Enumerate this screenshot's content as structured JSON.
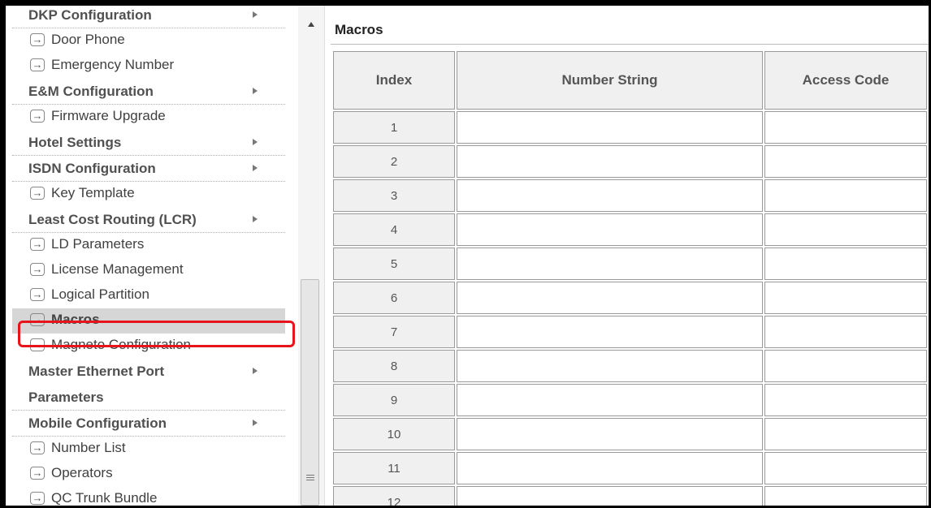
{
  "sidebar": {
    "items": [
      {
        "type": "cat",
        "label": "DKP Configuration",
        "submenu": true
      },
      {
        "type": "link",
        "label": "Door Phone"
      },
      {
        "type": "link",
        "label": "Emergency Number"
      },
      {
        "type": "cat",
        "label": "E&M Configuration",
        "submenu": true
      },
      {
        "type": "link",
        "label": "Firmware Upgrade"
      },
      {
        "type": "cat",
        "label": "Hotel Settings",
        "submenu": true
      },
      {
        "type": "cat",
        "label": "ISDN Configuration",
        "submenu": true
      },
      {
        "type": "link",
        "label": "Key Template"
      },
      {
        "type": "cat",
        "label": "Least Cost Routing (LCR)",
        "submenu": true
      },
      {
        "type": "link",
        "label": "LD Parameters"
      },
      {
        "type": "link",
        "label": "License Management"
      },
      {
        "type": "link",
        "label": "Logical Partition"
      },
      {
        "type": "link",
        "label": "Macros",
        "selected": true
      },
      {
        "type": "link",
        "label": "Magneto Configuration"
      },
      {
        "type": "cat",
        "label": "Master Ethernet Port",
        "label2": "Parameters",
        "submenu": true
      },
      {
        "type": "cat",
        "label": "Mobile Configuration",
        "submenu": true
      },
      {
        "type": "link",
        "label": "Number List"
      },
      {
        "type": "link",
        "label": "Operators"
      },
      {
        "type": "link",
        "label": "QC Trunk Bundle"
      }
    ]
  },
  "main": {
    "title": "Macros",
    "columns": [
      "Index",
      "Number String",
      "Access Code"
    ],
    "rows": [
      {
        "index": "1",
        "number_string": "",
        "access_code": ""
      },
      {
        "index": "2",
        "number_string": "",
        "access_code": ""
      },
      {
        "index": "3",
        "number_string": "",
        "access_code": ""
      },
      {
        "index": "4",
        "number_string": "",
        "access_code": ""
      },
      {
        "index": "5",
        "number_string": "",
        "access_code": ""
      },
      {
        "index": "6",
        "number_string": "",
        "access_code": ""
      },
      {
        "index": "7",
        "number_string": "",
        "access_code": ""
      },
      {
        "index": "8",
        "number_string": "",
        "access_code": ""
      },
      {
        "index": "9",
        "number_string": "",
        "access_code": ""
      },
      {
        "index": "10",
        "number_string": "",
        "access_code": ""
      },
      {
        "index": "11",
        "number_string": "",
        "access_code": ""
      },
      {
        "index": "12",
        "number_string": "",
        "access_code": ""
      }
    ]
  },
  "colors": {
    "highlight_border": "#e8141c",
    "selected_bg": "#d6d6d6"
  }
}
